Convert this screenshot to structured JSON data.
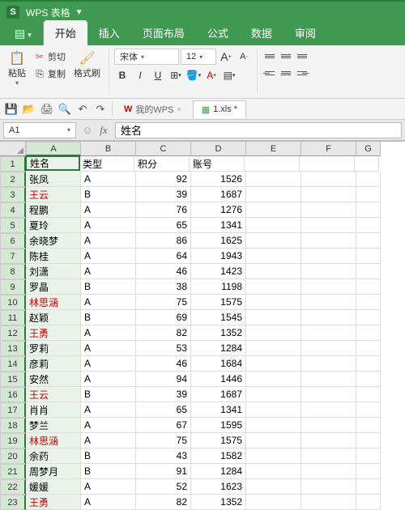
{
  "titlebar": {
    "app_name": "WPS 表格",
    "logo_letter": "S"
  },
  "tabs": {
    "file": "开始",
    "items": [
      "插入",
      "页面布局",
      "公式",
      "数据",
      "审阅"
    ]
  },
  "ribbon": {
    "paste": "粘贴",
    "cut": "剪切",
    "copy": "复制",
    "format_painter": "格式刷",
    "font_name": "宋体",
    "font_size": "12",
    "bold": "B",
    "italic": "I",
    "underline": "U",
    "increase_font": "A",
    "decrease_font": "A"
  },
  "qat": {
    "my_wps": "我的WPS",
    "file_name": "1.xls *"
  },
  "fbar": {
    "cell_ref": "A1",
    "fx": "fx",
    "formula_value": "姓名"
  },
  "chart_data": {
    "type": "table",
    "columns": [
      "A",
      "B",
      "C",
      "D",
      "E",
      "F",
      "G"
    ],
    "headers": {
      "A": "姓名",
      "B": "类型",
      "C": "积分",
      "D": "账号"
    },
    "rows": [
      {
        "n": 1,
        "A": "姓名",
        "B": "类型",
        "C": "积分",
        "D": "账号",
        "red": false
      },
      {
        "n": 2,
        "A": "张凤",
        "B": "A",
        "C": 92,
        "D": 1526,
        "red": false
      },
      {
        "n": 3,
        "A": "王云",
        "B": "B",
        "C": 39,
        "D": 1687,
        "red": true
      },
      {
        "n": 4,
        "A": "程鹏",
        "B": "A",
        "C": 76,
        "D": 1276,
        "red": false
      },
      {
        "n": 5,
        "A": "夏玲",
        "B": "A",
        "C": 65,
        "D": 1341,
        "red": false
      },
      {
        "n": 6,
        "A": "余晓梦",
        "B": "A",
        "C": 86,
        "D": 1625,
        "red": false
      },
      {
        "n": 7,
        "A": "陈桂",
        "B": "A",
        "C": 64,
        "D": 1943,
        "red": false
      },
      {
        "n": 8,
        "A": "刘潇",
        "B": "A",
        "C": 46,
        "D": 1423,
        "red": false
      },
      {
        "n": 9,
        "A": "罗晶",
        "B": "B",
        "C": 38,
        "D": 1198,
        "red": false
      },
      {
        "n": 10,
        "A": "林思涵",
        "B": "A",
        "C": 75,
        "D": 1575,
        "red": true
      },
      {
        "n": 11,
        "A": "赵颖",
        "B": "B",
        "C": 69,
        "D": 1545,
        "red": false
      },
      {
        "n": 12,
        "A": "王勇",
        "B": "A",
        "C": 82,
        "D": 1352,
        "red": true
      },
      {
        "n": 13,
        "A": "罗莉",
        "B": "A",
        "C": 53,
        "D": 1284,
        "red": false
      },
      {
        "n": 14,
        "A": "彦莉",
        "B": "A",
        "C": 46,
        "D": 1684,
        "red": false
      },
      {
        "n": 15,
        "A": "安然",
        "B": "A",
        "C": 94,
        "D": 1446,
        "red": false
      },
      {
        "n": 16,
        "A": "王云",
        "B": "B",
        "C": 39,
        "D": 1687,
        "red": true
      },
      {
        "n": 17,
        "A": "肖肖",
        "B": "A",
        "C": 65,
        "D": 1341,
        "red": false
      },
      {
        "n": 18,
        "A": "梦兰",
        "B": "A",
        "C": 67,
        "D": 1595,
        "red": false
      },
      {
        "n": 19,
        "A": "林思涵",
        "B": "A",
        "C": 75,
        "D": 1575,
        "red": true
      },
      {
        "n": 20,
        "A": "余药",
        "B": "B",
        "C": 43,
        "D": 1582,
        "red": false
      },
      {
        "n": 21,
        "A": "周梦月",
        "B": "B",
        "C": 91,
        "D": 1284,
        "red": false
      },
      {
        "n": 22,
        "A": "媛媛",
        "B": "A",
        "C": 52,
        "D": 1623,
        "red": false
      },
      {
        "n": 23,
        "A": "王勇",
        "B": "A",
        "C": 82,
        "D": 1352,
        "red": true
      }
    ]
  }
}
